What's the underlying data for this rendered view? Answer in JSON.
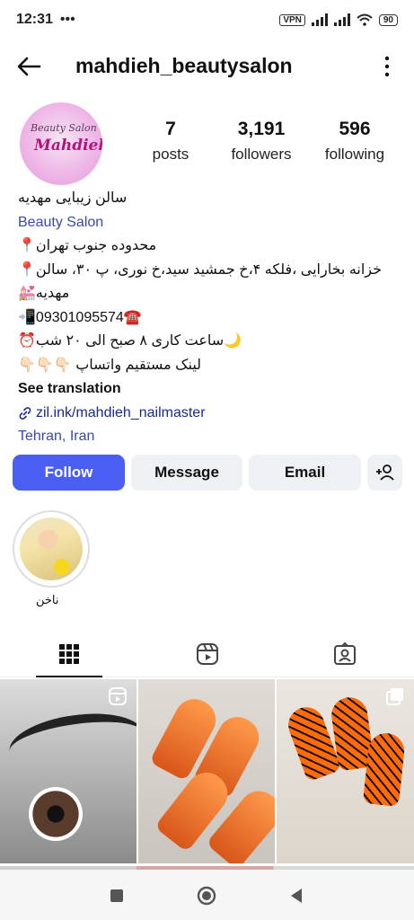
{
  "status_bar": {
    "time": "12:31",
    "notif_icons": "•••",
    "vpn": "VPN",
    "battery": "90"
  },
  "header": {
    "username": "mahdieh_beautysalon"
  },
  "avatar": {
    "line1": "Beauty Salon",
    "line2": "Mahdieh"
  },
  "stats": [
    {
      "value": "7",
      "label": "posts"
    },
    {
      "value": "3,191",
      "label": "followers"
    },
    {
      "value": "596",
      "label": "following"
    }
  ],
  "bio": {
    "name": "سالن زیبایی مهدیه",
    "category": "Beauty Salon",
    "line1": "محدوده جنوب تهران📍",
    "line2": "خزانه بخارایی ،فلکه ۴،خ جمشید سید،خ نوری، پ ۳۰، سالن📍",
    "line3": "مهدیه💒",
    "line4": "📲09301095574☎️",
    "line5": "🌙ساعت کاری ۸ صبح الی ۲۰ شب⏰",
    "line6": "لینک مستقیم واتساپ 👇🏻👇🏻👇🏻",
    "see_translation": "See translation",
    "link": "zil.ink/mahdieh_nailmaster",
    "location": "Tehran, Iran"
  },
  "buttons": {
    "follow": "Follow",
    "message": "Message",
    "email": "Email"
  },
  "highlight": {
    "label": "ناخن"
  },
  "colors": {
    "follow_button": "#4a5ff1",
    "link_blue": "#3949ab"
  }
}
